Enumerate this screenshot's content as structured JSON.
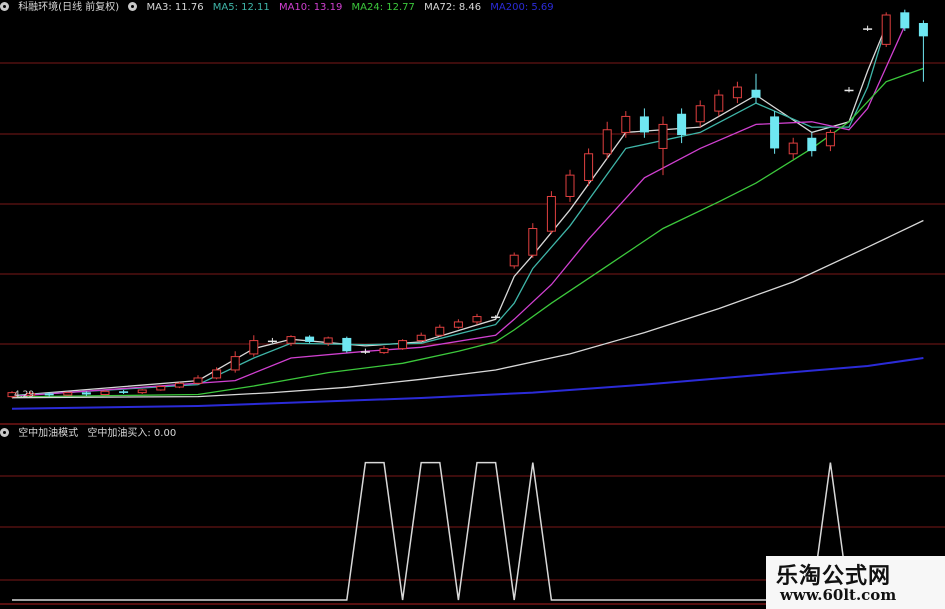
{
  "header_top": {
    "title": "科融环境(日线 前复权)",
    "items": [
      {
        "label": "MA3: 11.76",
        "color": "#d8d8d8"
      },
      {
        "label": "MA5: 12.11",
        "color": "#3fb5a8"
      },
      {
        "label": "MA10: 13.19",
        "color": "#d040d0"
      },
      {
        "label": "MA24: 12.77",
        "color": "#3cc83c"
      },
      {
        "label": "MA72: 8.46",
        "color": "#d8d8d8"
      },
      {
        "label": "MA200: 5.69",
        "color": "#2b2bd8"
      }
    ]
  },
  "header_bottom": {
    "title": "空中加油模式",
    "items": [
      {
        "label": "空中加油买入: 0.00",
        "color": "#d8d8d8"
      }
    ]
  },
  "price_pane": {
    "low_label": "4.29"
  },
  "colors": {
    "up": "#e04040",
    "down": "#6fe7f2",
    "ma3": "#d8d8d8",
    "ma5": "#3fb5a8",
    "ma10": "#d040d0",
    "ma24": "#3cc83c",
    "ma72": "#d8d8d8",
    "ma200": "#2b2bd8",
    "grid": "#7a1818",
    "signal": "#d8d8d8"
  },
  "watermark": {
    "title": "乐淘公式网",
    "url": "www.60lt.com"
  },
  "chart_data": [
    {
      "type": "line",
      "pane": "price",
      "candles": [
        [
          "up",
          4.3,
          4.45,
          4.25,
          4.5
        ],
        [
          "up",
          4.35,
          4.42,
          4.3,
          4.48
        ],
        [
          "down",
          4.42,
          4.35,
          4.3,
          4.46
        ],
        [
          "up",
          4.36,
          4.45,
          4.33,
          4.48
        ],
        [
          "down",
          4.46,
          4.38,
          4.33,
          4.5
        ],
        [
          "up",
          4.38,
          4.5,
          4.35,
          4.55
        ],
        [
          "down",
          4.5,
          4.44,
          4.4,
          4.55
        ],
        [
          "up",
          4.45,
          4.55,
          4.4,
          4.58
        ],
        [
          "up",
          4.55,
          4.68,
          4.52,
          4.72
        ],
        [
          "up",
          4.66,
          4.8,
          4.62,
          4.85
        ],
        [
          "up",
          4.8,
          5.0,
          4.75,
          5.1
        ],
        [
          "up",
          5.0,
          5.3,
          4.95,
          5.4
        ],
        [
          "up",
          5.3,
          5.8,
          5.2,
          6.0
        ],
        [
          "up",
          5.9,
          6.4,
          5.8,
          6.6
        ],
        [
          "flat",
          6.4,
          6.4,
          6.3,
          6.5
        ],
        [
          "up",
          6.3,
          6.55,
          6.2,
          6.6
        ],
        [
          "down",
          6.55,
          6.35,
          6.3,
          6.6
        ],
        [
          "up",
          6.3,
          6.5,
          6.2,
          6.55
        ],
        [
          "down",
          6.5,
          6.0,
          5.95,
          6.55
        ],
        [
          "flat",
          6.0,
          6.0,
          5.9,
          6.1
        ],
        [
          "up",
          5.95,
          6.1,
          5.9,
          6.2
        ],
        [
          "up",
          6.1,
          6.4,
          6.05,
          6.45
        ],
        [
          "up",
          6.4,
          6.6,
          6.35,
          6.7
        ],
        [
          "up",
          6.6,
          6.9,
          6.55,
          7.0
        ],
        [
          "up",
          6.9,
          7.1,
          6.85,
          7.2
        ],
        [
          "up",
          7.1,
          7.3,
          7.0,
          7.4
        ],
        [
          "flat",
          7.3,
          7.3,
          7.25,
          7.35
        ],
        [
          "up",
          9.2,
          9.6,
          9.1,
          9.7
        ],
        [
          "up",
          9.6,
          10.6,
          9.5,
          10.8
        ],
        [
          "up",
          10.5,
          11.8,
          10.4,
          12.0
        ],
        [
          "up",
          11.8,
          12.6,
          11.6,
          12.8
        ],
        [
          "up",
          12.4,
          13.4,
          12.2,
          13.6
        ],
        [
          "up",
          13.4,
          14.3,
          13.2,
          14.6
        ],
        [
          "up",
          14.2,
          14.8,
          14.0,
          15.0
        ],
        [
          "down",
          14.8,
          14.2,
          14.0,
          15.1
        ],
        [
          "up",
          13.6,
          14.5,
          12.6,
          14.8
        ],
        [
          "down",
          14.9,
          14.1,
          13.8,
          15.1
        ],
        [
          "up",
          14.6,
          15.2,
          14.4,
          15.4
        ],
        [
          "up",
          15.0,
          15.6,
          14.8,
          15.8
        ],
        [
          "up",
          15.5,
          15.9,
          15.3,
          16.1
        ],
        [
          "down",
          15.8,
          15.5,
          15.3,
          16.4
        ],
        [
          "down",
          14.8,
          13.6,
          13.4,
          15.0
        ],
        [
          "up",
          13.4,
          13.8,
          13.2,
          14.0
        ],
        [
          "down",
          14.0,
          13.5,
          13.3,
          14.2
        ],
        [
          "up",
          13.7,
          14.2,
          13.5,
          14.3
        ],
        [
          "flat",
          15.8,
          15.8,
          15.7,
          15.9
        ],
        [
          "flat",
          18.1,
          18.1,
          18.0,
          18.2
        ],
        [
          "up",
          17.5,
          18.6,
          17.4,
          18.7
        ],
        [
          "down",
          18.7,
          18.1,
          18.0,
          18.8
        ],
        [
          "down",
          18.3,
          17.8,
          16.1,
          18.4
        ]
      ],
      "ma_lines": {
        "MA3": [
          [
            0,
            4.34
          ],
          [
            10,
            4.9
          ],
          [
            13,
            6.1
          ],
          [
            15,
            6.45
          ],
          [
            19,
            6.2
          ],
          [
            22,
            6.35
          ],
          [
            26,
            7.2
          ],
          [
            27,
            8.8
          ],
          [
            28,
            9.6
          ],
          [
            30,
            11.3
          ],
          [
            33,
            14.2
          ],
          [
            37,
            14.4
          ],
          [
            40,
            15.6
          ],
          [
            43,
            14.2
          ],
          [
            45,
            14.6
          ],
          [
            46,
            16.5
          ],
          [
            47,
            18.2
          ]
        ],
        "MA5": [
          [
            0,
            4.33
          ],
          [
            10,
            4.75
          ],
          [
            13,
            5.75
          ],
          [
            15,
            6.3
          ],
          [
            19,
            6.25
          ],
          [
            22,
            6.3
          ],
          [
            26,
            7.0
          ],
          [
            27,
            7.8
          ],
          [
            28,
            9.1
          ],
          [
            30,
            10.7
          ],
          [
            33,
            13.6
          ],
          [
            37,
            14.2
          ],
          [
            40,
            15.3
          ],
          [
            43,
            14.4
          ],
          [
            45,
            14.4
          ],
          [
            46,
            15.9
          ],
          [
            47,
            18.2
          ]
        ],
        "MA10": [
          [
            0,
            4.31
          ],
          [
            12,
            4.9
          ],
          [
            15,
            5.75
          ],
          [
            19,
            6.0
          ],
          [
            22,
            6.15
          ],
          [
            26,
            6.6
          ],
          [
            27,
            7.2
          ],
          [
            29,
            8.5
          ],
          [
            31,
            10.2
          ],
          [
            34,
            12.5
          ],
          [
            37,
            13.6
          ],
          [
            40,
            14.5
          ],
          [
            43,
            14.6
          ],
          [
            45,
            14.3
          ],
          [
            46,
            15.1
          ],
          [
            48,
            18.2
          ]
        ],
        "MA24": [
          [
            0,
            4.29
          ],
          [
            10,
            4.38
          ],
          [
            13,
            4.7
          ],
          [
            17,
            5.2
          ],
          [
            21,
            5.55
          ],
          [
            24,
            6.0
          ],
          [
            26,
            6.35
          ],
          [
            27,
            6.8
          ],
          [
            29,
            7.8
          ],
          [
            32,
            9.2
          ],
          [
            35,
            10.6
          ],
          [
            38,
            11.6
          ],
          [
            40,
            12.3
          ],
          [
            43,
            13.6
          ],
          [
            45,
            14.6
          ],
          [
            47,
            16.1
          ],
          [
            49,
            16.6
          ]
        ],
        "MA72": [
          [
            0,
            4.26
          ],
          [
            10,
            4.3
          ],
          [
            14,
            4.45
          ],
          [
            18,
            4.65
          ],
          [
            22,
            4.95
          ],
          [
            26,
            5.3
          ],
          [
            30,
            5.9
          ],
          [
            34,
            6.7
          ],
          [
            38,
            7.6
          ],
          [
            42,
            8.6
          ],
          [
            46,
            9.9
          ],
          [
            49,
            10.9
          ]
        ],
        "MA200": [
          [
            0,
            3.85
          ],
          [
            10,
            3.95
          ],
          [
            16,
            4.1
          ],
          [
            22,
            4.25
          ],
          [
            28,
            4.45
          ],
          [
            34,
            4.75
          ],
          [
            40,
            5.1
          ],
          [
            46,
            5.45
          ],
          [
            49,
            5.75
          ]
        ]
      },
      "ylim": [
        3.5,
        18.6
      ],
      "grid": true
    },
    {
      "type": "line",
      "pane": "indicator",
      "x": [
        0,
        18,
        19,
        20,
        21,
        22,
        23,
        24,
        25,
        26,
        27,
        28,
        29,
        30,
        31,
        32,
        33,
        34,
        35,
        36,
        37,
        38,
        39,
        40,
        41,
        42,
        43,
        44,
        45,
        46,
        47,
        48,
        49
      ],
      "values": [
        0,
        0,
        1,
        1,
        0,
        1,
        1,
        0,
        1,
        1,
        0,
        1,
        0,
        0,
        0,
        0,
        0,
        0,
        0,
        0,
        0,
        0,
        0,
        0,
        0,
        0,
        0,
        1,
        0,
        0,
        0,
        0,
        0
      ],
      "ylim": [
        0,
        1.15
      ],
      "grid": true
    }
  ]
}
